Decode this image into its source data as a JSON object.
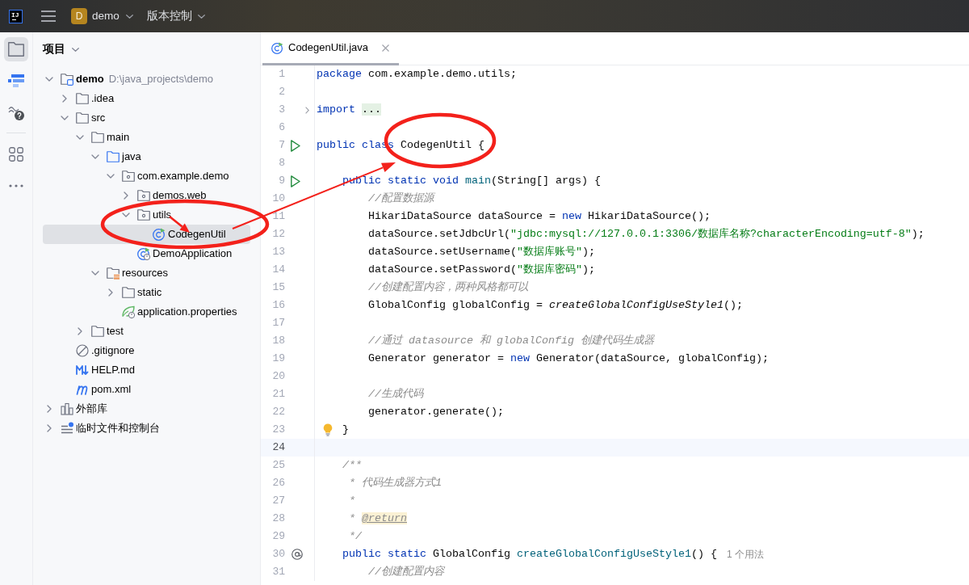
{
  "topbar": {
    "logo": "IJ",
    "project": {
      "initial": "D",
      "name": "demo"
    },
    "vcs": "版本控制"
  },
  "tool_groups": [
    [
      {
        "kind": "project",
        "selected": true
      },
      {
        "kind": "plugin",
        "selected": false
      },
      {
        "kind": "help",
        "selected": false
      }
    ],
    [
      {
        "kind": "grid",
        "selected": false
      },
      {
        "kind": "more",
        "selected": false
      }
    ]
  ],
  "project_panel": {
    "title": "项目",
    "tree": [
      {
        "label": "demo",
        "path": "D:\\java_projects\\demo",
        "kind": "module",
        "expanded": true,
        "selected": false,
        "children": [
          {
            "label": ".idea",
            "kind": "folder",
            "expanded": false,
            "selected": false
          },
          {
            "label": "src",
            "kind": "folder",
            "expanded": true,
            "selected": false,
            "children": [
              {
                "label": "main",
                "kind": "folder",
                "expanded": true,
                "selected": false,
                "children": [
                  {
                    "label": "java",
                    "kind": "source",
                    "expanded": true,
                    "selected": false,
                    "children": [
                      {
                        "label": "com.example.demo",
                        "kind": "package",
                        "expanded": true,
                        "selected": false,
                        "children": [
                          {
                            "label": "demos.web",
                            "kind": "package",
                            "expanded": false,
                            "selected": false
                          },
                          {
                            "label": "utils",
                            "kind": "package",
                            "expanded": true,
                            "selected": false,
                            "children": [
                              {
                                "label": "CodegenUtil",
                                "kind": "class",
                                "selected": true
                              }
                            ]
                          },
                          {
                            "label": "DemoApplication",
                            "kind": "spring-app",
                            "selected": false
                          }
                        ]
                      }
                    ]
                  },
                  {
                    "label": "resources",
                    "kind": "resources",
                    "expanded": true,
                    "selected": false,
                    "children": [
                      {
                        "label": "static",
                        "kind": "folder",
                        "expanded": false,
                        "selected": false
                      },
                      {
                        "label": "application.properties",
                        "kind": "spring-props",
                        "selected": false
                      }
                    ]
                  }
                ]
              },
              {
                "label": "test",
                "kind": "folder",
                "expanded": false,
                "selected": false
              }
            ]
          },
          {
            "label": ".gitignore",
            "kind": "gitignore",
            "selected": false
          },
          {
            "label": "HELP.md",
            "kind": "markdown",
            "selected": false
          },
          {
            "label": "pom.xml",
            "kind": "maven",
            "selected": false
          }
        ]
      },
      {
        "label": "外部库",
        "kind": "library",
        "expanded": false,
        "selected": false
      },
      {
        "label": "临时文件和控制台",
        "kind": "scratches",
        "expanded": false,
        "selected": false
      }
    ]
  },
  "editor": {
    "tabs": [
      {
        "label": "CodegenUtil.java",
        "kind": "class",
        "selected": true
      }
    ],
    "lines": [
      {
        "number": "1",
        "current": false,
        "tokens": [
          {
            "kind": "keyword",
            "text": "package"
          },
          {
            "kind": "plain",
            "text": " com.example.demo.utils;"
          }
        ]
      },
      {
        "number": "2",
        "current": false
      },
      {
        "number": "3",
        "current": false,
        "marker": {
          "kind": "fold"
        },
        "tokens": [
          {
            "kind": "keyword",
            "text": "import "
          },
          {
            "kind": "folded",
            "text": "..."
          }
        ]
      },
      {
        "number": "6",
        "current": false
      },
      {
        "number": "7",
        "current": false,
        "marker": {
          "kind": "run"
        },
        "tokens": [
          {
            "kind": "keyword",
            "text": "public class"
          },
          {
            "kind": "plain",
            "text": " CodegenUtil {"
          }
        ]
      },
      {
        "number": "8",
        "current": false
      },
      {
        "number": "9",
        "current": false,
        "marker": {
          "kind": "run"
        },
        "tokens": [
          {
            "kind": "keyword",
            "text": "    public static void "
          },
          {
            "kind": "method",
            "text": "main"
          },
          {
            "kind": "plain",
            "text": "(String[] args) {"
          }
        ]
      },
      {
        "number": "10",
        "current": false,
        "tokens": [
          {
            "kind": "comment",
            "text": "        //配置数据源"
          }
        ]
      },
      {
        "number": "11",
        "current": false,
        "tokens": [
          {
            "kind": "plain",
            "text": "        HikariDataSource dataSource = "
          },
          {
            "kind": "keyword",
            "text": "new"
          },
          {
            "kind": "plain",
            "text": " HikariDataSource();"
          }
        ]
      },
      {
        "number": "12",
        "current": false,
        "tokens": [
          {
            "kind": "plain",
            "text": "        dataSource.setJdbcUrl("
          },
          {
            "kind": "string",
            "text": "\"jdbc:mysql://127.0.0.1:3306/数据库名称?characterEncoding=utf-8\""
          },
          {
            "kind": "plain",
            "text": ");"
          }
        ]
      },
      {
        "number": "13",
        "current": false,
        "tokens": [
          {
            "kind": "plain",
            "text": "        dataSource.setUsername("
          },
          {
            "kind": "string",
            "text": "\"数据库账号\""
          },
          {
            "kind": "plain",
            "text": ");"
          }
        ]
      },
      {
        "number": "14",
        "current": false,
        "tokens": [
          {
            "kind": "plain",
            "text": "        dataSource.setPassword("
          },
          {
            "kind": "string",
            "text": "\"数据库密码\""
          },
          {
            "kind": "plain",
            "text": ");"
          }
        ]
      },
      {
        "number": "15",
        "current": false,
        "tokens": [
          {
            "kind": "comment",
            "text": "        //创建配置内容，两种风格都可以"
          }
        ]
      },
      {
        "number": "16",
        "current": false,
        "tokens": [
          {
            "kind": "plain",
            "text": "        GlobalConfig globalConfig = "
          },
          {
            "kind": "static-call",
            "text": "createGlobalConfigUseStyle1"
          },
          {
            "kind": "plain",
            "text": "();"
          }
        ]
      },
      {
        "number": "17",
        "current": false
      },
      {
        "number": "18",
        "current": false,
        "tokens": [
          {
            "kind": "comment",
            "text": "        //通过 datasource 和 globalConfig 创建代码生成器"
          }
        ]
      },
      {
        "number": "19",
        "current": false,
        "tokens": [
          {
            "kind": "plain",
            "text": "        Generator generator = "
          },
          {
            "kind": "keyword",
            "text": "new"
          },
          {
            "kind": "plain",
            "text": " Generator(dataSource, globalConfig);"
          }
        ]
      },
      {
        "number": "20",
        "current": false
      },
      {
        "number": "21",
        "current": false,
        "tokens": [
          {
            "kind": "comment",
            "text": "        //生成代码"
          }
        ]
      },
      {
        "number": "22",
        "current": false,
        "tokens": [
          {
            "kind": "plain",
            "text": "        generator.generate();"
          }
        ]
      },
      {
        "number": "23",
        "current": false,
        "marker": {
          "kind": "bulb"
        },
        "tokens": [
          {
            "kind": "plain",
            "text": "    }"
          }
        ]
      },
      {
        "number": "24",
        "current": true
      },
      {
        "number": "25",
        "current": false,
        "tokens": [
          {
            "kind": "doc",
            "text": "    /**"
          }
        ]
      },
      {
        "number": "26",
        "current": false,
        "tokens": [
          {
            "kind": "doc",
            "text": "     * 代码生成器方式1"
          }
        ]
      },
      {
        "number": "27",
        "current": false,
        "tokens": [
          {
            "kind": "doc",
            "text": "     *"
          }
        ]
      },
      {
        "number": "28",
        "current": false,
        "tokens": [
          {
            "kind": "doc",
            "text": "     * "
          },
          {
            "kind": "doc-tag",
            "text": "@return"
          }
        ]
      },
      {
        "number": "29",
        "current": false,
        "tokens": [
          {
            "kind": "doc",
            "text": "     */"
          }
        ]
      },
      {
        "number": "30",
        "current": false,
        "marker": {
          "kind": "override"
        },
        "hint": "1 个用法",
        "tokens": [
          {
            "kind": "keyword",
            "text": "    public static"
          },
          {
            "kind": "plain",
            "text": " GlobalConfig "
          },
          {
            "kind": "method",
            "text": "createGlobalConfigUseStyle1"
          },
          {
            "kind": "plain",
            "text": "() {"
          }
        ]
      },
      {
        "number": "31",
        "current": false,
        "tokens": [
          {
            "kind": "comment",
            "text": "        //创建配置内容"
          }
        ]
      }
    ]
  },
  "annotations": [
    {
      "kind": "ellipse"
    },
    {
      "kind": "arrow"
    },
    {
      "kind": "arrow"
    },
    {
      "kind": "ellipse"
    }
  ]
}
